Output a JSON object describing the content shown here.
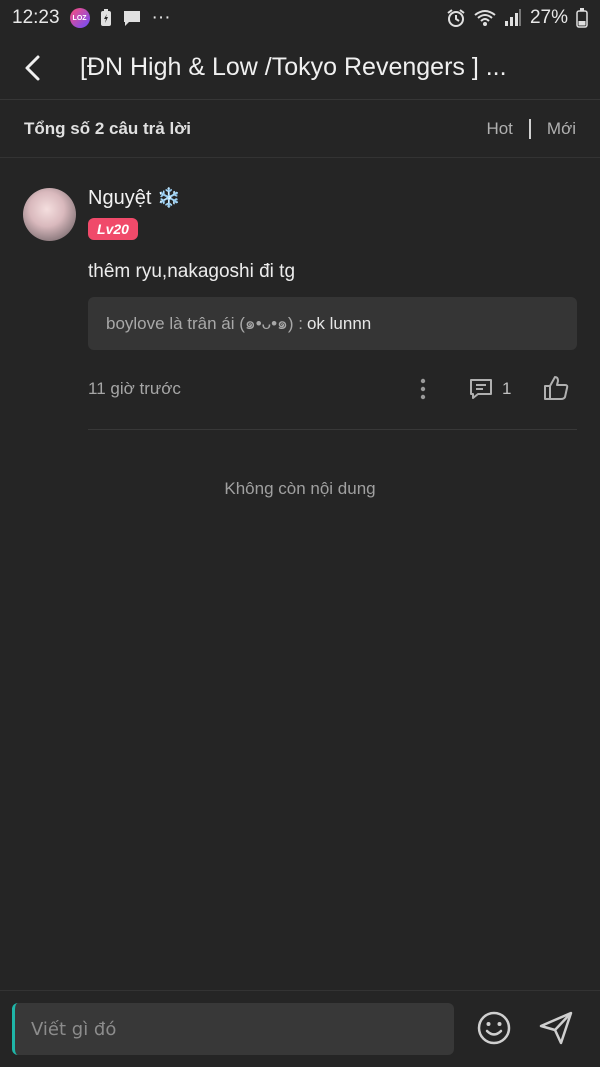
{
  "status_bar": {
    "time": "12:23",
    "app_badge": "LOZ",
    "dots": "···",
    "battery": "27%"
  },
  "header": {
    "title": "[ĐN High & Low /Tokyo Revengers ] ..."
  },
  "subbar": {
    "total": "Tổng số 2 câu trả lời",
    "sort_hot": "Hot",
    "sort_new": "Mới"
  },
  "comment": {
    "author": "Nguyệt",
    "author_emoji": "❄️",
    "level": "Lv20",
    "text": "thêm ryu,nakagoshi đi tg",
    "reply": {
      "author": "boylove là trân ái (๑•ᴗ•๑) :",
      "text": "ok lunnn"
    },
    "time": "11 giờ trước",
    "reply_count": "1"
  },
  "no_more": "Không còn nội dung",
  "footer": {
    "placeholder": "Viết gì đó"
  },
  "colors": {
    "background": "#252525",
    "level_badge": "#f04a6a",
    "cursor": "#1fb6a8"
  }
}
